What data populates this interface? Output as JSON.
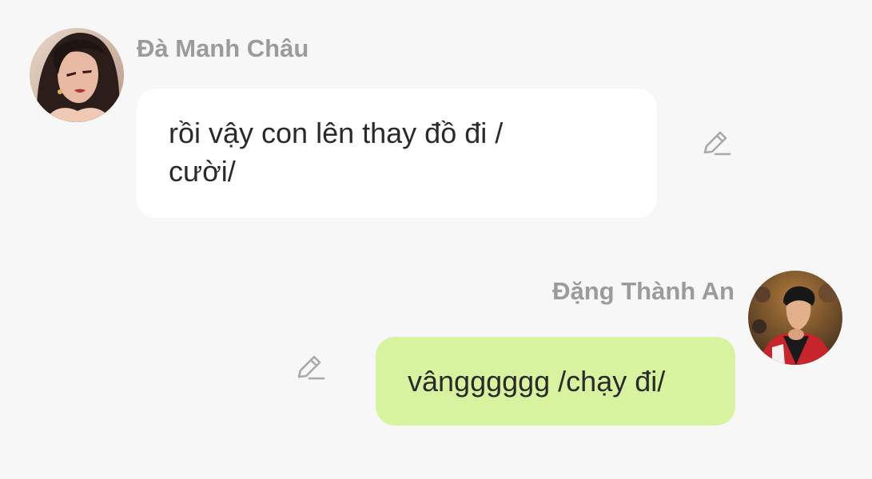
{
  "messages": [
    {
      "sender": "Đà Manh Châu",
      "text": "rồi vậy con lên thay đồ đi /\ncười/",
      "side": "left",
      "bubble_color": "#ffffff",
      "avatar_icon": "avatar-woman-illustration-icon",
      "edit_icon": "pencil-edit-icon"
    },
    {
      "sender": "Đặng Thành An",
      "text": "vângggggg /chạy đi/",
      "side": "right",
      "bubble_color": "#d7f3a0",
      "avatar_icon": "avatar-young-man-photo-icon",
      "edit_icon": "pencil-edit-icon"
    }
  ],
  "colors": {
    "background": "#f7f7f7",
    "name_text": "#9b9b9b",
    "message_text": "#2a2a2a"
  }
}
